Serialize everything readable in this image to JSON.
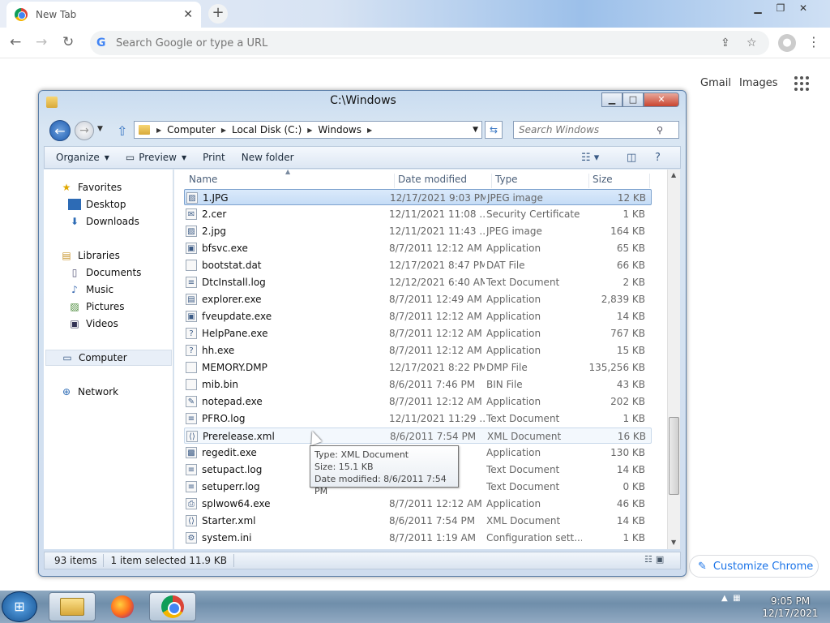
{
  "browser": {
    "tab_title": "New Tab",
    "omnibox_placeholder": "Search Google or type a URL",
    "gmail": "Gmail",
    "images": "Images",
    "customize": "Customize Chrome"
  },
  "explorer": {
    "title": "C:\\Windows",
    "breadcrumbs": [
      "Computer",
      "Local Disk (C:)",
      "Windows"
    ],
    "search_placeholder": "Search Windows",
    "toolbar": {
      "organize": "Organize",
      "preview": "Preview",
      "print": "Print",
      "new_folder": "New folder"
    },
    "nav": {
      "favorites": "Favorites",
      "desktop": "Desktop",
      "downloads": "Downloads",
      "libraries": "Libraries",
      "documents": "Documents",
      "music": "Music",
      "pictures": "Pictures",
      "videos": "Videos",
      "computer": "Computer",
      "network": "Network"
    },
    "columns": {
      "name": "Name",
      "date": "Date modified",
      "type": "Type",
      "size": "Size"
    },
    "files": [
      {
        "name": "1.JPG",
        "date": "12/17/2021 9:03 PM",
        "type": "JPEG image",
        "size": "12 KB",
        "icon": "image-icon"
      },
      {
        "name": "2.cer",
        "date": "12/11/2021 11:08 ...",
        "type": "Security Certificate",
        "size": "1 KB",
        "icon": "certificate-icon"
      },
      {
        "name": "2.jpg",
        "date": "12/11/2021 11:43 ...",
        "type": "JPEG image",
        "size": "164 KB",
        "icon": "image-icon"
      },
      {
        "name": "bfsvc.exe",
        "date": "8/7/2011 12:12 AM",
        "type": "Application",
        "size": "65 KB",
        "icon": "application-icon"
      },
      {
        "name": "bootstat.dat",
        "date": "12/17/2021 8:47 PM",
        "type": "DAT File",
        "size": "66 KB",
        "icon": "file-icon"
      },
      {
        "name": "DtcInstall.log",
        "date": "12/12/2021 6:40 AM",
        "type": "Text Document",
        "size": "2 KB",
        "icon": "text-file-icon"
      },
      {
        "name": "explorer.exe",
        "date": "8/7/2011 12:49 AM",
        "type": "Application",
        "size": "2,839 KB",
        "icon": "folder-app-icon"
      },
      {
        "name": "fveupdate.exe",
        "date": "8/7/2011 12:12 AM",
        "type": "Application",
        "size": "14 KB",
        "icon": "application-icon"
      },
      {
        "name": "HelpPane.exe",
        "date": "8/7/2011 12:12 AM",
        "type": "Application",
        "size": "767 KB",
        "icon": "help-icon"
      },
      {
        "name": "hh.exe",
        "date": "8/7/2011 12:12 AM",
        "type": "Application",
        "size": "15 KB",
        "icon": "help-file-icon"
      },
      {
        "name": "MEMORY.DMP",
        "date": "12/17/2021 8:22 PM",
        "type": "DMP File",
        "size": "135,256 KB",
        "icon": "file-icon"
      },
      {
        "name": "mib.bin",
        "date": "8/6/2011 7:46 PM",
        "type": "BIN File",
        "size": "43 KB",
        "icon": "file-icon"
      },
      {
        "name": "notepad.exe",
        "date": "8/7/2011 12:12 AM",
        "type": "Application",
        "size": "202 KB",
        "icon": "notepad-icon"
      },
      {
        "name": "PFRO.log",
        "date": "12/11/2021 11:29 ...",
        "type": "Text Document",
        "size": "1 KB",
        "icon": "text-file-icon"
      },
      {
        "name": "Prerelease.xml",
        "date": "8/6/2011 7:54 PM",
        "type": "XML Document",
        "size": "16 KB",
        "icon": "xml-file-icon"
      },
      {
        "name": "regedit.exe",
        "date": "",
        "type": "Application",
        "size": "130 KB",
        "icon": "regedit-icon"
      },
      {
        "name": "setupact.log",
        "date": "",
        "type": "Text Document",
        "size": "14 KB",
        "icon": "text-file-icon"
      },
      {
        "name": "setuperr.log",
        "date": "",
        "type": "Text Document",
        "size": "0 KB",
        "icon": "text-file-icon"
      },
      {
        "name": "splwow64.exe",
        "date": "8/7/2011 12:12 AM",
        "type": "Application",
        "size": "46 KB",
        "icon": "printer-app-icon"
      },
      {
        "name": "Starter.xml",
        "date": "8/6/2011 7:54 PM",
        "type": "XML Document",
        "size": "14 KB",
        "icon": "xml-file-icon"
      },
      {
        "name": "system.ini",
        "date": "8/7/2011 1:19 AM",
        "type": "Configuration sett...",
        "size": "1 KB",
        "icon": "config-file-icon"
      }
    ],
    "selected_index": 0,
    "hover_index": 14,
    "tooltip": {
      "type": "Type: XML Document",
      "size": "Size: 15.1 KB",
      "date": "Date modified: 8/6/2011 7:54 PM"
    },
    "status": {
      "items": "93 items",
      "selected": "1 item selected  11.9 KB"
    }
  },
  "taskbar": {
    "time": "9:05 PM",
    "date": "12/17/2021"
  }
}
